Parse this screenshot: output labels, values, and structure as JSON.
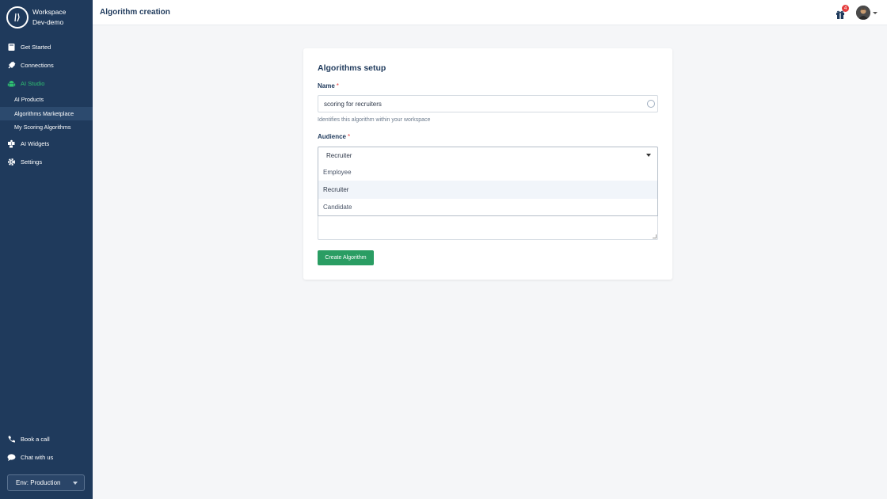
{
  "sidebar": {
    "workspace_label": "Workspace",
    "workspace_name": "Dev-demo",
    "nav": {
      "get_started": "Get Started",
      "connections": "Connections",
      "ai_studio": "AI Studio",
      "ai_widgets": "AI Widgets",
      "settings": "Settings"
    },
    "sub": {
      "ai_products": "AI Products",
      "algorithms_marketplace": "Algorithms Marketplace",
      "my_scoring_algorithms": "My Scoring Algorithms"
    },
    "bottom": {
      "book_call": "Book a call",
      "chat": "Chat with us"
    },
    "env": "Env: Production"
  },
  "topbar": {
    "title": "Algorithm creation",
    "notification_count": "4"
  },
  "card": {
    "title": "Algorithms setup",
    "name_label": "Name",
    "required_mark": "*",
    "name_value": "scoring for recruiters",
    "name_help": "Identifies this algorithm within your workspace",
    "audience_label": "Audience",
    "audience_selected": "Recruiter",
    "audience_options": [
      "Employee",
      "Recruiter",
      "Candidate"
    ],
    "create_button": "Create Algorithm"
  },
  "colors": {
    "sidebar_bg": "#1f3a5c",
    "accent_green": "#2a9d63",
    "active_nav": "#2fbf71",
    "badge_red": "#e53e3e"
  }
}
